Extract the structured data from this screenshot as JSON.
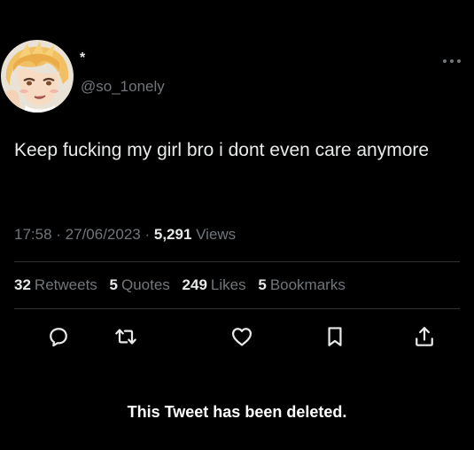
{
  "profile": {
    "display_name": "*",
    "handle": "@so_1onely",
    "avatar_icon": "anime-avatar"
  },
  "more_icon": "more-options-icon",
  "tweet": {
    "text": "Keep fucking my girl bro i dont even care anymore"
  },
  "meta": {
    "time": "17:58",
    "sep1": " · ",
    "date": "27/06/2023",
    "sep2": " · ",
    "views_count": "5,291",
    "views_label": "Views"
  },
  "stats": {
    "retweets_count": "32",
    "retweets_label": "Retweets",
    "quotes_count": "5",
    "quotes_label": "Quotes",
    "likes_count": "249",
    "likes_label": "Likes",
    "bookmarks_count": "5",
    "bookmarks_label": "Bookmarks"
  },
  "actions": [
    "reply-icon",
    "retweet-icon",
    "like-icon",
    "bookmark-icon",
    "share-icon"
  ],
  "notice": "This Tweet has been deleted.",
  "colors": {
    "background": "#000000",
    "text_primary": "#e7e9ea",
    "text_secondary": "#71767b",
    "divider": "#2f3336"
  }
}
